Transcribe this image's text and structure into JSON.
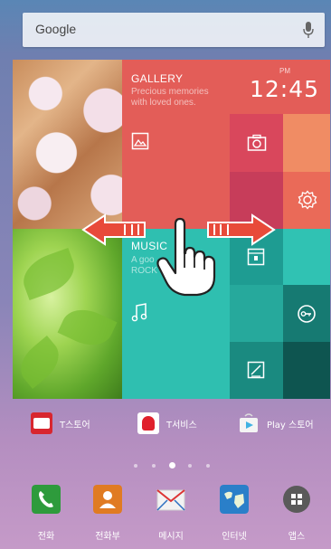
{
  "search": {
    "label": "Google",
    "icon": "mic-icon"
  },
  "tiles": {
    "gallery": {
      "title": "GALLERY",
      "subtitle_line1": "Precious memories",
      "subtitle_line2": "with loved ones.",
      "icon": "image-icon"
    },
    "clock": {
      "ampm": "PM",
      "time": "12:45"
    },
    "camera": {
      "icon": "camera-icon"
    },
    "settings": {
      "icon": "gear-icon"
    },
    "music": {
      "title": "MUSIC",
      "subtitle_line1": "A goo",
      "subtitle_line2": "ROCK",
      "icon": "music-note-icon"
    },
    "box": {
      "icon": "archive-icon"
    },
    "key": {
      "icon": "key-icon"
    },
    "memo": {
      "icon": "memo-icon"
    }
  },
  "quick_apps": [
    {
      "label": "T스토어",
      "icon": "tstore-icon"
    },
    {
      "label": "T서비스",
      "icon": "tservice-icon"
    },
    {
      "label": "Play 스토어",
      "icon": "play-store-icon"
    }
  ],
  "page_indicator": {
    "count": 5,
    "active": 3
  },
  "dock": [
    {
      "label": "전화",
      "icon": "phone-icon",
      "color": "#2e9b3c"
    },
    {
      "label": "전화부",
      "icon": "contacts-icon",
      "color": "#e07b22"
    },
    {
      "label": "메시지",
      "icon": "message-icon",
      "color": "#f2f2f2"
    },
    {
      "label": "인터넷",
      "icon": "globe-icon",
      "color": "#2a7fc9"
    },
    {
      "label": "앱스",
      "icon": "apps-grid-icon",
      "color": "#5a5a5a"
    }
  ],
  "colors": {
    "gallery": "#e35d58",
    "music": "#2fbfb0",
    "accent_teal_dark": "#0e5550"
  }
}
